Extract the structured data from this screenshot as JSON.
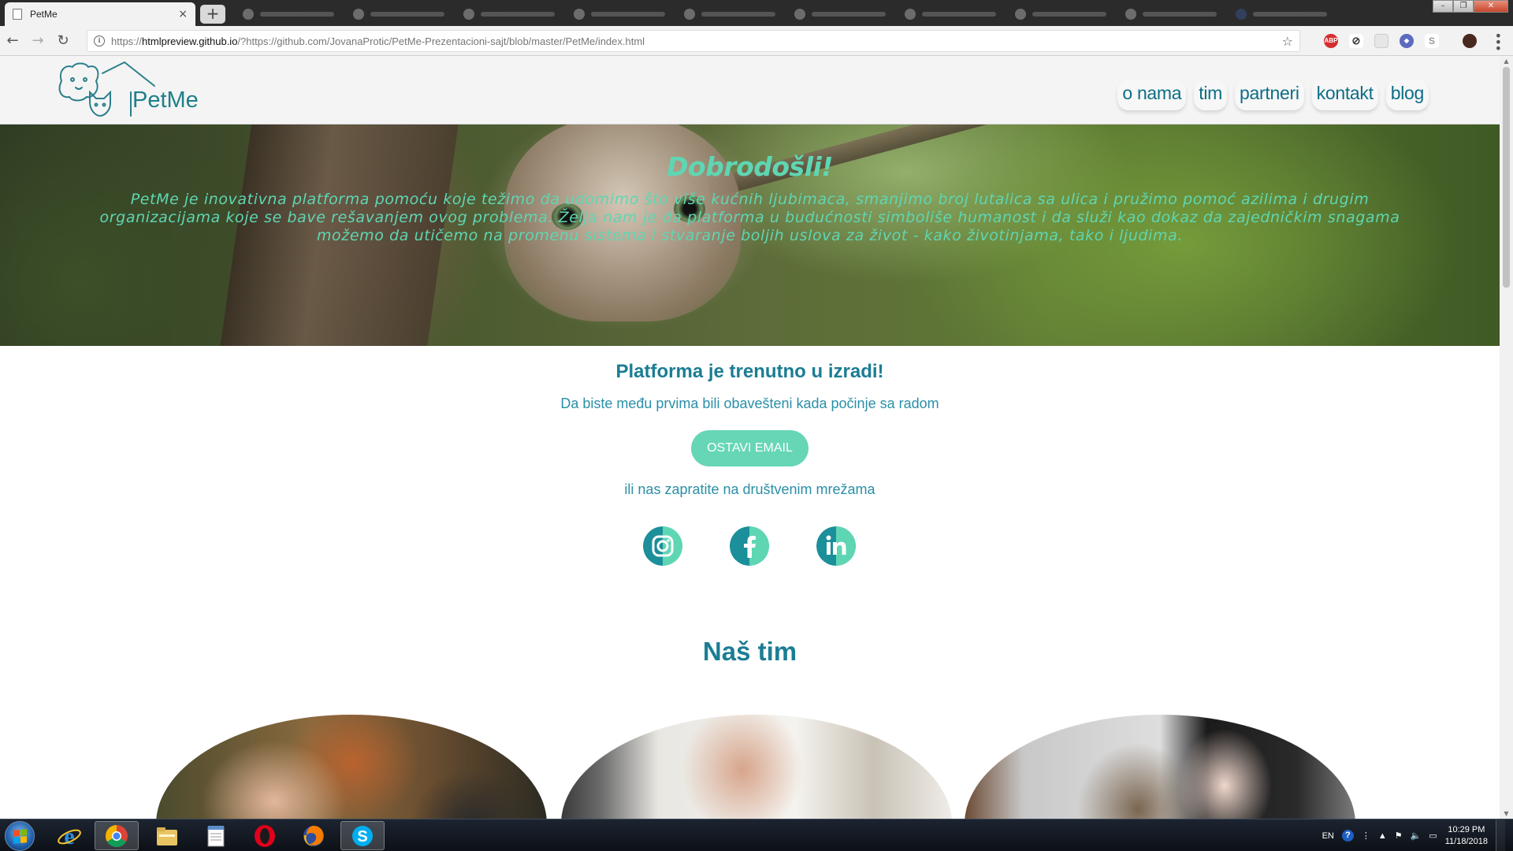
{
  "browser": {
    "tab_title": "PetMe",
    "tab_close": "×",
    "new_tab": "+",
    "url_prefix": "https://",
    "url_host": "htmlpreview.github.io",
    "url_rest": "/?https://github.com/JovanaProtic/PetMe-Prezentacioni-sajt/blob/master/PetMe/index.html",
    "extensions": [
      {
        "name": "adblock-plus-icon",
        "label": "ABP",
        "color": "#d32f2f"
      },
      {
        "name": "sync-icon",
        "label": "",
        "color": "#333333"
      },
      {
        "name": "extension-icon",
        "label": "",
        "color": "#dddddd"
      },
      {
        "name": "shield-extension-icon",
        "label": "",
        "color": "#5c6bc0"
      },
      {
        "name": "skype-extension-icon",
        "label": "",
        "color": "#bbbbbb"
      }
    ]
  },
  "site": {
    "logo_text": "PetMe",
    "nav": [
      "o nama",
      "tim",
      "partneri",
      "kontakt",
      "blog"
    ],
    "hero": {
      "title": "Dobrodošli!",
      "text": "PetMe je inovativna platforma pomoću koje težimo da udomimo što više kućnih ljubimaca, smanjimo broj lutalica sa ulica i pružimo pomoć azilima i drugim organizacijama koje se bave rešavanjem ovog problema. Želja nam je da platforma u budućnosti simboliše humanost i da služi kao dokaz da zajedničkim snagama možemo da utičemo na promenu sistema i stvaranje boljih uslova za život - kako životinjama, tako i ljudima."
    },
    "content": {
      "title": "Platforma je trenutno u izradi!",
      "subtitle": "Da biste među prvima bili obavešteni kada počinje sa radom",
      "email_button": "OSTAVI EMAIL",
      "social_text": "ili nas zapratite na društvenim mrežama"
    },
    "social": [
      "instagram-icon",
      "facebook-icon",
      "linkedin-icon"
    ],
    "team_title": "Naš tim",
    "colors": {
      "teal": "#1b7d94",
      "mint": "#66d6b6",
      "hero_text": "#5fd6b3"
    }
  },
  "taskbar": {
    "apps": [
      "internet-explorer-icon",
      "chrome-icon",
      "file-explorer-icon",
      "notepad-icon",
      "opera-icon",
      "firefox-icon",
      "skype-icon"
    ],
    "lang": "EN",
    "time": "10:29 PM",
    "date": "11/18/2018"
  }
}
